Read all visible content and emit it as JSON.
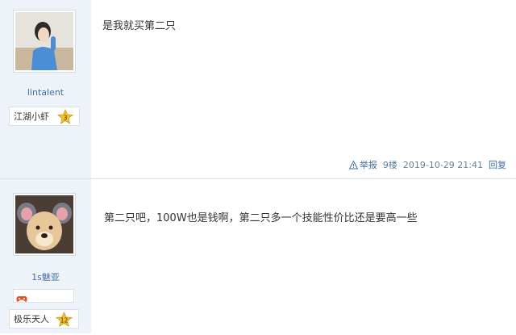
{
  "posts": [
    {
      "username": "lintalent",
      "rank_title": "江湖小虾",
      "level": "3",
      "content": "是我就买第二只",
      "report_label": "举报",
      "floor": "9楼",
      "time": "2019-10-29 21:41",
      "reply_label": "回复"
    },
    {
      "username": "1s魅亚",
      "rank_title": "极乐天人",
      "level": "12",
      "content": "第二只吧，100W也是钱啊，第二只多一个技能性价比还是要高一些"
    }
  ],
  "colors": {
    "sidebar_bg": "#eef3f9",
    "link": "#3f6ea6",
    "star": "#f2c230"
  },
  "icons": [
    "warning-icon",
    "star-badge-icon",
    "game-controller-icon"
  ]
}
